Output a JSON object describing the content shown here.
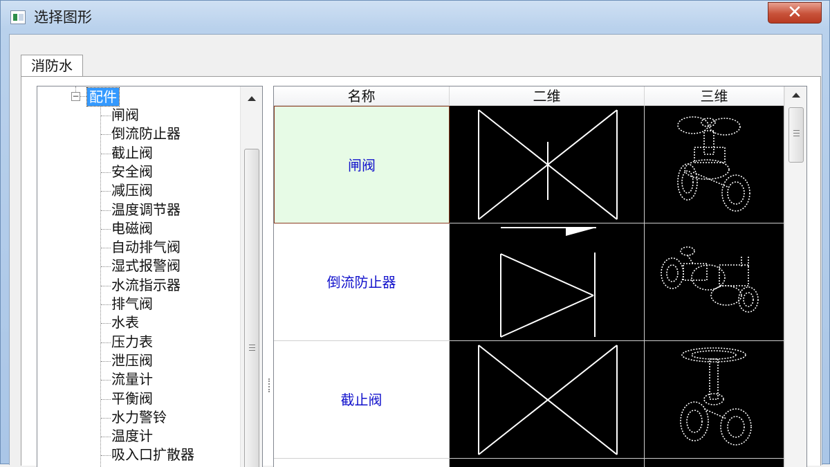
{
  "window": {
    "title": "选择图形",
    "close_label": "✕"
  },
  "tabs": [
    {
      "label": "消防水"
    }
  ],
  "tree": {
    "root_label": "配件",
    "expander": "−",
    "items": [
      "闸阀",
      "倒流防止器",
      "截止阀",
      "安全阀",
      "减压阀",
      "温度调节器",
      "电磁阀",
      "自动排气阀",
      "湿式报警阀",
      "水流指示器",
      "排气阀",
      "水表",
      "压力表",
      "泄压阀",
      "流量计",
      "平衡阀",
      "水力警铃",
      "温度计",
      "吸入口扩散器"
    ]
  },
  "grid": {
    "headers": [
      "名称",
      "二维",
      "三维"
    ],
    "rows": [
      {
        "name": "闸阀",
        "symbol_2d": "gate-valve-2d-symbol",
        "model_3d": "gate-valve-3d-wireframe",
        "selected": true
      },
      {
        "name": "倒流防止器",
        "symbol_2d": "backflow-preventer-2d-symbol",
        "model_3d": "backflow-preventer-3d-wireframe",
        "selected": false
      },
      {
        "name": "截止阀",
        "symbol_2d": "globe-valve-2d-symbol",
        "model_3d": "globe-valve-3d-wireframe",
        "selected": false
      }
    ]
  },
  "colors": {
    "selected_row_bg": "#e7fbe6",
    "name_text": "#1212cc",
    "preview_bg": "#000000",
    "tree_selection": "#3399ff"
  }
}
